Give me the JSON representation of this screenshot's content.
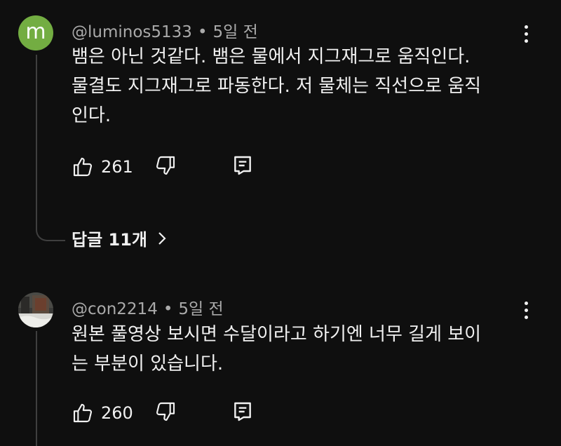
{
  "comments": [
    {
      "avatar_letter": "m",
      "avatar_color": "#73ad42",
      "handle": "@luminos5133",
      "separator": "•",
      "time": "5일 전",
      "lines": [
        "뱀은 아닌 것같다. 뱀은 물에서 지그재그로 움직인다.",
        "물결도 지그재그로 파동한다. 저 물체는 직선으로 움직",
        "인다."
      ],
      "likes": "261",
      "replies_label": "답글 11개"
    },
    {
      "avatar": "photo-avatar",
      "handle": "@con2214",
      "separator": "•",
      "time": "5일 전",
      "lines": [
        "원본 풀영상 보시면 수달이라고 하기엔 너무 길게 보이",
        "는 부분이 있습니다."
      ],
      "likes": "260"
    }
  ],
  "icons": {
    "like": "thumb-up-icon",
    "dislike": "thumb-down-icon",
    "reply": "comment-icon",
    "more": "more-vert-icon",
    "chevron": "chevron-right-icon"
  },
  "colors": {
    "background": "#0f0f0f",
    "text": "#f1f1f1",
    "muted": "#aaaaaa",
    "thread_line": "#3f3f3f"
  }
}
